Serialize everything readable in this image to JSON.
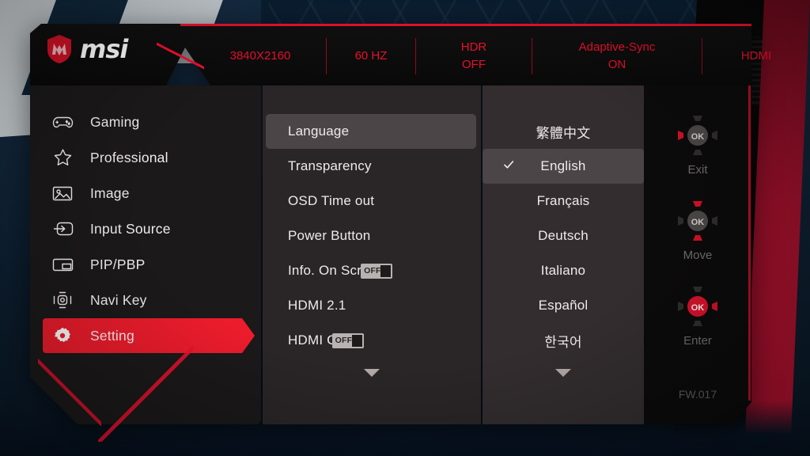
{
  "brand": {
    "logo_text": "msi",
    "logo_icon": "msi-dragon-shield-icon"
  },
  "status_bar": {
    "items": [
      {
        "name": "resolution",
        "line1": "3840X2160",
        "line2": ""
      },
      {
        "name": "refresh-rate",
        "line1": "60 HZ",
        "line2": ""
      },
      {
        "name": "hdr",
        "line1": "HDR",
        "line2": "OFF"
      },
      {
        "name": "adaptive-sync",
        "line1": "Adaptive-Sync",
        "line2": "ON"
      },
      {
        "name": "input",
        "line1": "HDMI",
        "line2": ""
      }
    ]
  },
  "sidebar": {
    "items": [
      {
        "label": "Gaming",
        "icon": "gamepad-icon",
        "active": false
      },
      {
        "label": "Professional",
        "icon": "star-icon",
        "active": false
      },
      {
        "label": "Image",
        "icon": "picture-icon",
        "active": false
      },
      {
        "label": "Input Source",
        "icon": "input-arrow-icon",
        "active": false
      },
      {
        "label": "PIP/PBP",
        "icon": "split-screen-icon",
        "active": false
      },
      {
        "label": "Navi Key",
        "icon": "dpad-icon",
        "active": false
      },
      {
        "label": "Setting",
        "icon": "gear-icon",
        "active": true
      }
    ]
  },
  "settings_menu": {
    "items": [
      {
        "label": "Language",
        "selected": true,
        "toggle": null
      },
      {
        "label": "Transparency",
        "selected": false,
        "toggle": null
      },
      {
        "label": "OSD Time out",
        "selected": false,
        "toggle": null
      },
      {
        "label": "Power Button",
        "selected": false,
        "toggle": null
      },
      {
        "label": "Info. On Screen",
        "selected": false,
        "toggle": "OFF"
      },
      {
        "label": "HDMI 2.1",
        "selected": false,
        "toggle": null
      },
      {
        "label": "HDMI CEC",
        "selected": false,
        "toggle": "OFF"
      }
    ],
    "scroll_down_icon": "chevron-down-icon"
  },
  "language_menu": {
    "items": [
      {
        "label": "繁體中文",
        "selected": false,
        "checked": false
      },
      {
        "label": "English",
        "selected": true,
        "checked": true
      },
      {
        "label": "Français",
        "selected": false,
        "checked": false
      },
      {
        "label": "Deutsch",
        "selected": false,
        "checked": false
      },
      {
        "label": "Italiano",
        "selected": false,
        "checked": false
      },
      {
        "label": "Español",
        "selected": false,
        "checked": false
      },
      {
        "label": "한국어",
        "selected": false,
        "checked": false
      }
    ],
    "scroll_down_icon": "chevron-down-icon"
  },
  "nav_hints": {
    "items": [
      {
        "label": "Exit",
        "icon": "navi-key-left-icon"
      },
      {
        "label": "Move",
        "icon": "navi-key-updown-icon"
      },
      {
        "label": "Enter",
        "icon": "navi-key-ok-icon"
      }
    ],
    "firmware": "FW.017"
  },
  "colors": {
    "accent_red": "#e8112d",
    "highlight_red": "#ec1c2c",
    "panel_dark": "#1b1919",
    "panel_mid": "#2a2627",
    "panel_light": "#332d2f",
    "row_highlight": "#4b4547",
    "text": "#efeaea"
  }
}
